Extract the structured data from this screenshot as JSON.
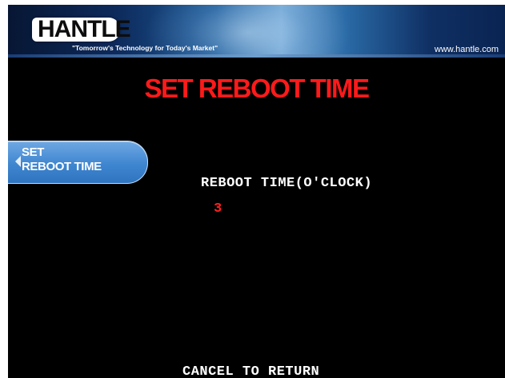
{
  "header": {
    "logo": "HANTLE",
    "tagline": "\"Tomorrow's Technology for Today's Market\"",
    "website": "www.hantle.com"
  },
  "screen": {
    "title": "SET REBOOT TIME"
  },
  "side_menu": {
    "items": [
      {
        "label": "SET\nREBOOT TIME"
      }
    ]
  },
  "form": {
    "label": "REBOOT TIME(O'CLOCK)",
    "value": "3"
  },
  "footer": {
    "instruction": "CANCEL TO RETURN"
  },
  "colors": {
    "title": "#ff1a1a",
    "value": "#ff2020",
    "button": "#3f86d0",
    "background": "#000000"
  }
}
